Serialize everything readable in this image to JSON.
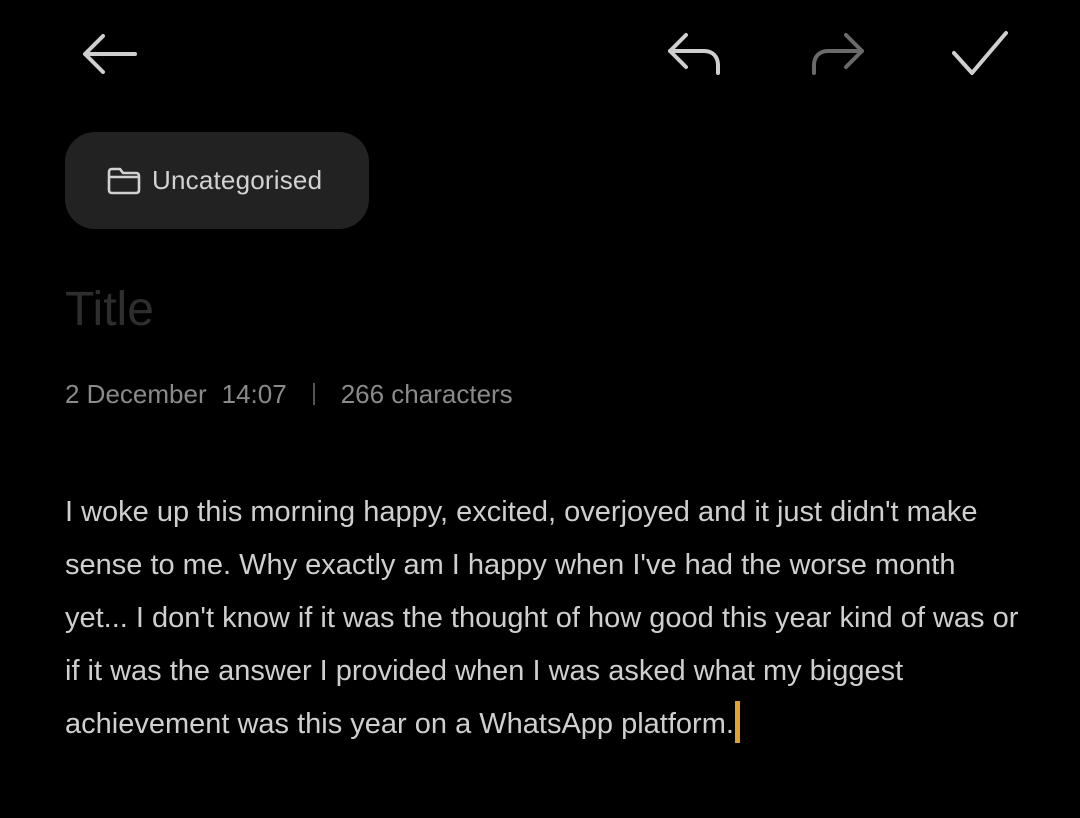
{
  "toolbar": {
    "back_icon": "arrow-left-icon",
    "undo_icon": "undo-icon",
    "redo_icon": "redo-icon",
    "done_icon": "checkmark-icon",
    "redo_enabled": false
  },
  "folder": {
    "icon": "folder-icon",
    "label": "Uncategorised"
  },
  "note": {
    "title_placeholder": "Title",
    "date": "2 December",
    "time": "14:07",
    "character_count": "266 characters",
    "body": "I woke up this morning happy, excited, overjoyed and it just didn't make sense to me. Why exactly am I happy when I've had the worse month yet... I don't know if it was the thought of how good this year kind of was or if it was the answer I provided when I was asked what my biggest achievement was this year on a WhatsApp platform."
  },
  "colors": {
    "background": "#000000",
    "chip_background": "#222222",
    "caret": "#e3a22c",
    "icon_active": "#cfcfcf",
    "icon_disabled": "#6a6a6a"
  }
}
